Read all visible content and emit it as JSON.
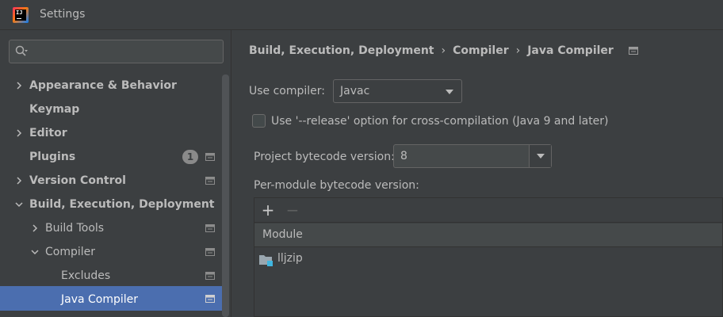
{
  "window": {
    "title": "Settings"
  },
  "search": {
    "placeholder": ""
  },
  "sidebar": {
    "items": [
      {
        "label": "Appearance & Behavior"
      },
      {
        "label": "Keymap"
      },
      {
        "label": "Editor"
      },
      {
        "label": "Plugins",
        "badge": "1"
      },
      {
        "label": "Version Control"
      },
      {
        "label": "Build, Execution, Deployment"
      },
      {
        "label": "Build Tools"
      },
      {
        "label": "Compiler"
      },
      {
        "label": "Excludes"
      },
      {
        "label": "Java Compiler"
      }
    ],
    "selected": "Java Compiler"
  },
  "breadcrumb": {
    "items": [
      "Build, Execution, Deployment",
      "Compiler",
      "Java Compiler"
    ],
    "separator": "›"
  },
  "form": {
    "use_compiler_label": "Use compiler:",
    "use_compiler_value": "Javac",
    "release_option_label": "Use '--release' option for cross-compilation (Java 9 and later)",
    "release_option_checked": false,
    "project_bytecode_label": "Project bytecode version:",
    "project_bytecode_value": "8",
    "per_module_label": "Per-module bytecode version:"
  },
  "module_table": {
    "toolbar": {
      "add": "+",
      "remove": "−"
    },
    "columns": [
      "Module"
    ],
    "rows": [
      {
        "module": "lljzip"
      }
    ]
  },
  "colors": {
    "background": "#3c3f41",
    "selection": "#4b6eaf",
    "text": "#bbbbbb",
    "border": "#646464"
  }
}
